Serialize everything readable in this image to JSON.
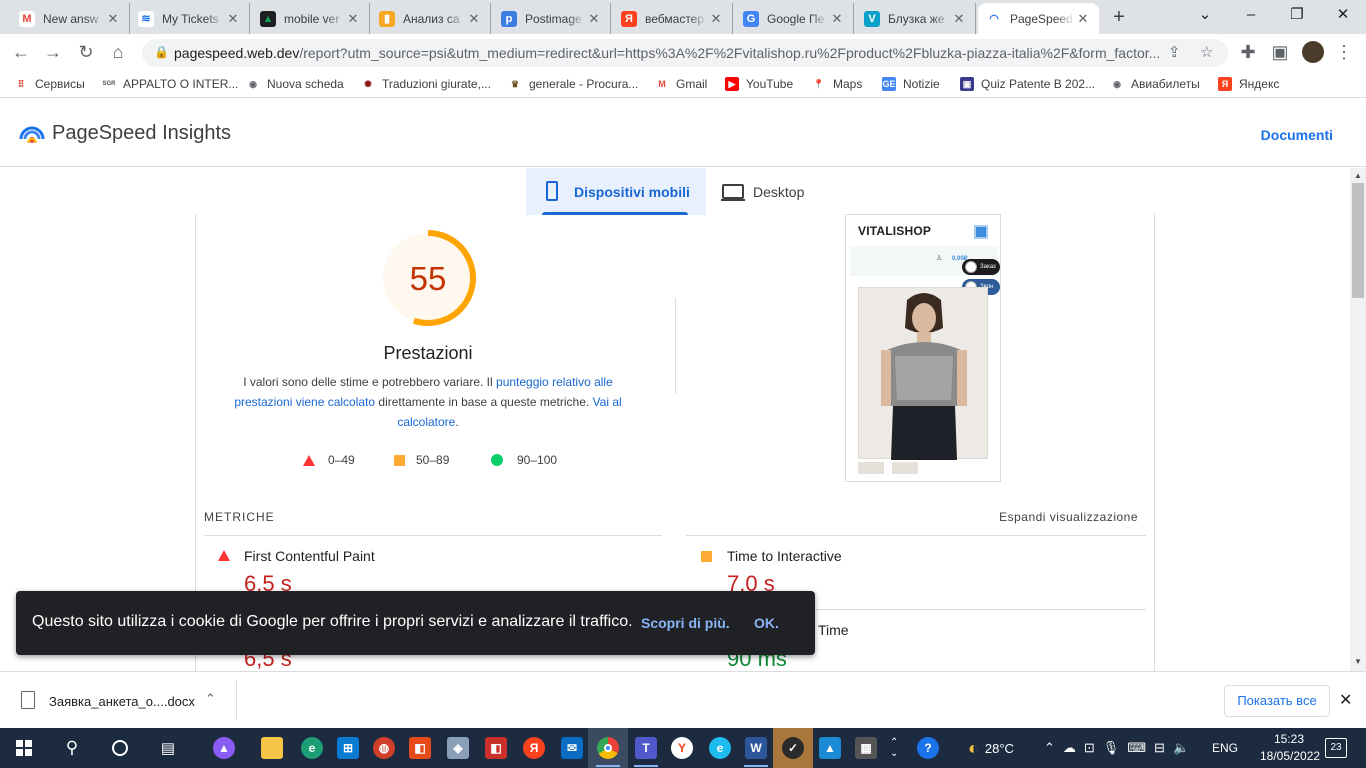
{
  "tabs": [
    {
      "title": "New answ",
      "fav": "M",
      "color": "#ea4335",
      "bg": "#ffffff"
    },
    {
      "title": "My Tickets",
      "fav": "≋",
      "color": "#1a73e8",
      "bg": "#ffffff"
    },
    {
      "title": "mobile ver",
      "fav": "▲",
      "color": "#0f9d58",
      "bg": "#1e1e1e"
    },
    {
      "title": "Анализ са",
      "fav": "▮",
      "color": "#ffffff",
      "bg": "#f9a825"
    },
    {
      "title": "Postimage",
      "fav": "p",
      "color": "#ffffff",
      "bg": "#3d7de0"
    },
    {
      "title": "вебмастер",
      "fav": "Я",
      "color": "#ffffff",
      "bg": "#fc3f1d"
    },
    {
      "title": "Google Пе",
      "fav": "G",
      "color": "#ffffff",
      "bg": "#4285f4"
    },
    {
      "title": "Блузка же",
      "fav": "V",
      "color": "#ffffff",
      "bg": "#0aa0c8"
    },
    {
      "title": "PageSpeed",
      "fav": "◠",
      "color": "#1a73e8",
      "bg": "#ffffff"
    }
  ],
  "address": {
    "host": "pagespeed.web.dev",
    "path": "/report?utm_source=psi&utm_medium=redirect&url=https%3A%2F%2Fvitalishop.ru%2Fproduct%2Fbluzka-piazza-italia%2F&form_factor..."
  },
  "bookmarks": [
    {
      "label": "Сервисы",
      "fav": "⠿",
      "bg": "#ffffff",
      "color": "#d93025"
    },
    {
      "label": "APPALTO O INTER...",
      "fav": "SGR",
      "bg": "#ffffff",
      "color": "#555555"
    },
    {
      "label": "Nuova scheda",
      "fav": "◉",
      "bg": "#ffffff",
      "color": "#5f6368"
    },
    {
      "label": "Traduzioni giurate,...",
      "fav": "✺",
      "bg": "#ffffff",
      "color": "#8b1a1a"
    },
    {
      "label": "generale - Procura...",
      "fav": "♛",
      "bg": "#ffffff",
      "color": "#6b4f1d"
    },
    {
      "label": "Gmail",
      "fav": "M",
      "bg": "#ffffff",
      "color": "#ea4335"
    },
    {
      "label": "YouTube",
      "fav": "▶",
      "bg": "#ff0000",
      "color": "#ffffff"
    },
    {
      "label": "Maps",
      "fav": "📍",
      "bg": "#ffffff",
      "color": "#34a853"
    },
    {
      "label": "Notizie",
      "fav": "GE",
      "bg": "#4285f4",
      "color": "#ffffff"
    },
    {
      "label": "Quiz Patente B 202...",
      "fav": "▣",
      "bg": "#3a3a8c",
      "color": "#ffffff"
    },
    {
      "label": "Авиабилеты",
      "fav": "◉",
      "bg": "#ffffff",
      "color": "#5f6368"
    },
    {
      "label": "Яндекс",
      "fav": "Я",
      "bg": "#fc3f1d",
      "color": "#ffffff"
    }
  ],
  "psi": {
    "title": "PageSpeed Insights",
    "docs_link": "Documenti",
    "tab_mobile": "Dispositivi mobili",
    "tab_desktop": "Desktop",
    "score": "55",
    "score_value": 55,
    "score_color": "#ffa400",
    "score_label": "Prestazioni",
    "desc_1": "I valori sono delle stime e potrebbero variare. Il ",
    "desc_link_1": "punteggio relativo alle prestazioni viene calcolato",
    "desc_2": " direttamente in base a queste metriche. ",
    "desc_link_2": "Vai al calcolatore",
    "desc_3": ".",
    "legend": [
      "0–49",
      "50–89",
      "90–100"
    ],
    "metrics_heading": "METRICHE",
    "expand_view": "Espandi visualizzazione",
    "metrics": [
      {
        "label": "First Contentful Paint",
        "value": "6,5 s",
        "status": "fail"
      },
      {
        "label": "Time to Interactive",
        "value": "7,0 s",
        "status": "average"
      },
      {
        "label": "",
        "value": "6,5 s",
        "status": "fail"
      },
      {
        "label": "Time",
        "value": "90 ms",
        "status": "pass"
      }
    ]
  },
  "preview": {
    "brand": "VITALISHOP",
    "price": "0,00₽",
    "pill_1": "Заказ",
    "pill_2": "Звон"
  },
  "cookie": {
    "message": "Questo sito utilizza i cookie di Google per offrire i propri servizi e analizzare il traffico.",
    "learn_more": "Scopri di più.",
    "ok": "OK."
  },
  "download": {
    "filename": "Заявка_анкета_о....docx",
    "show_all": "Показать все"
  },
  "taskbar": {
    "weather": "28°C",
    "lang": "ENG",
    "time": "15:23",
    "date": "18/05/2022",
    "notifications": "23"
  }
}
